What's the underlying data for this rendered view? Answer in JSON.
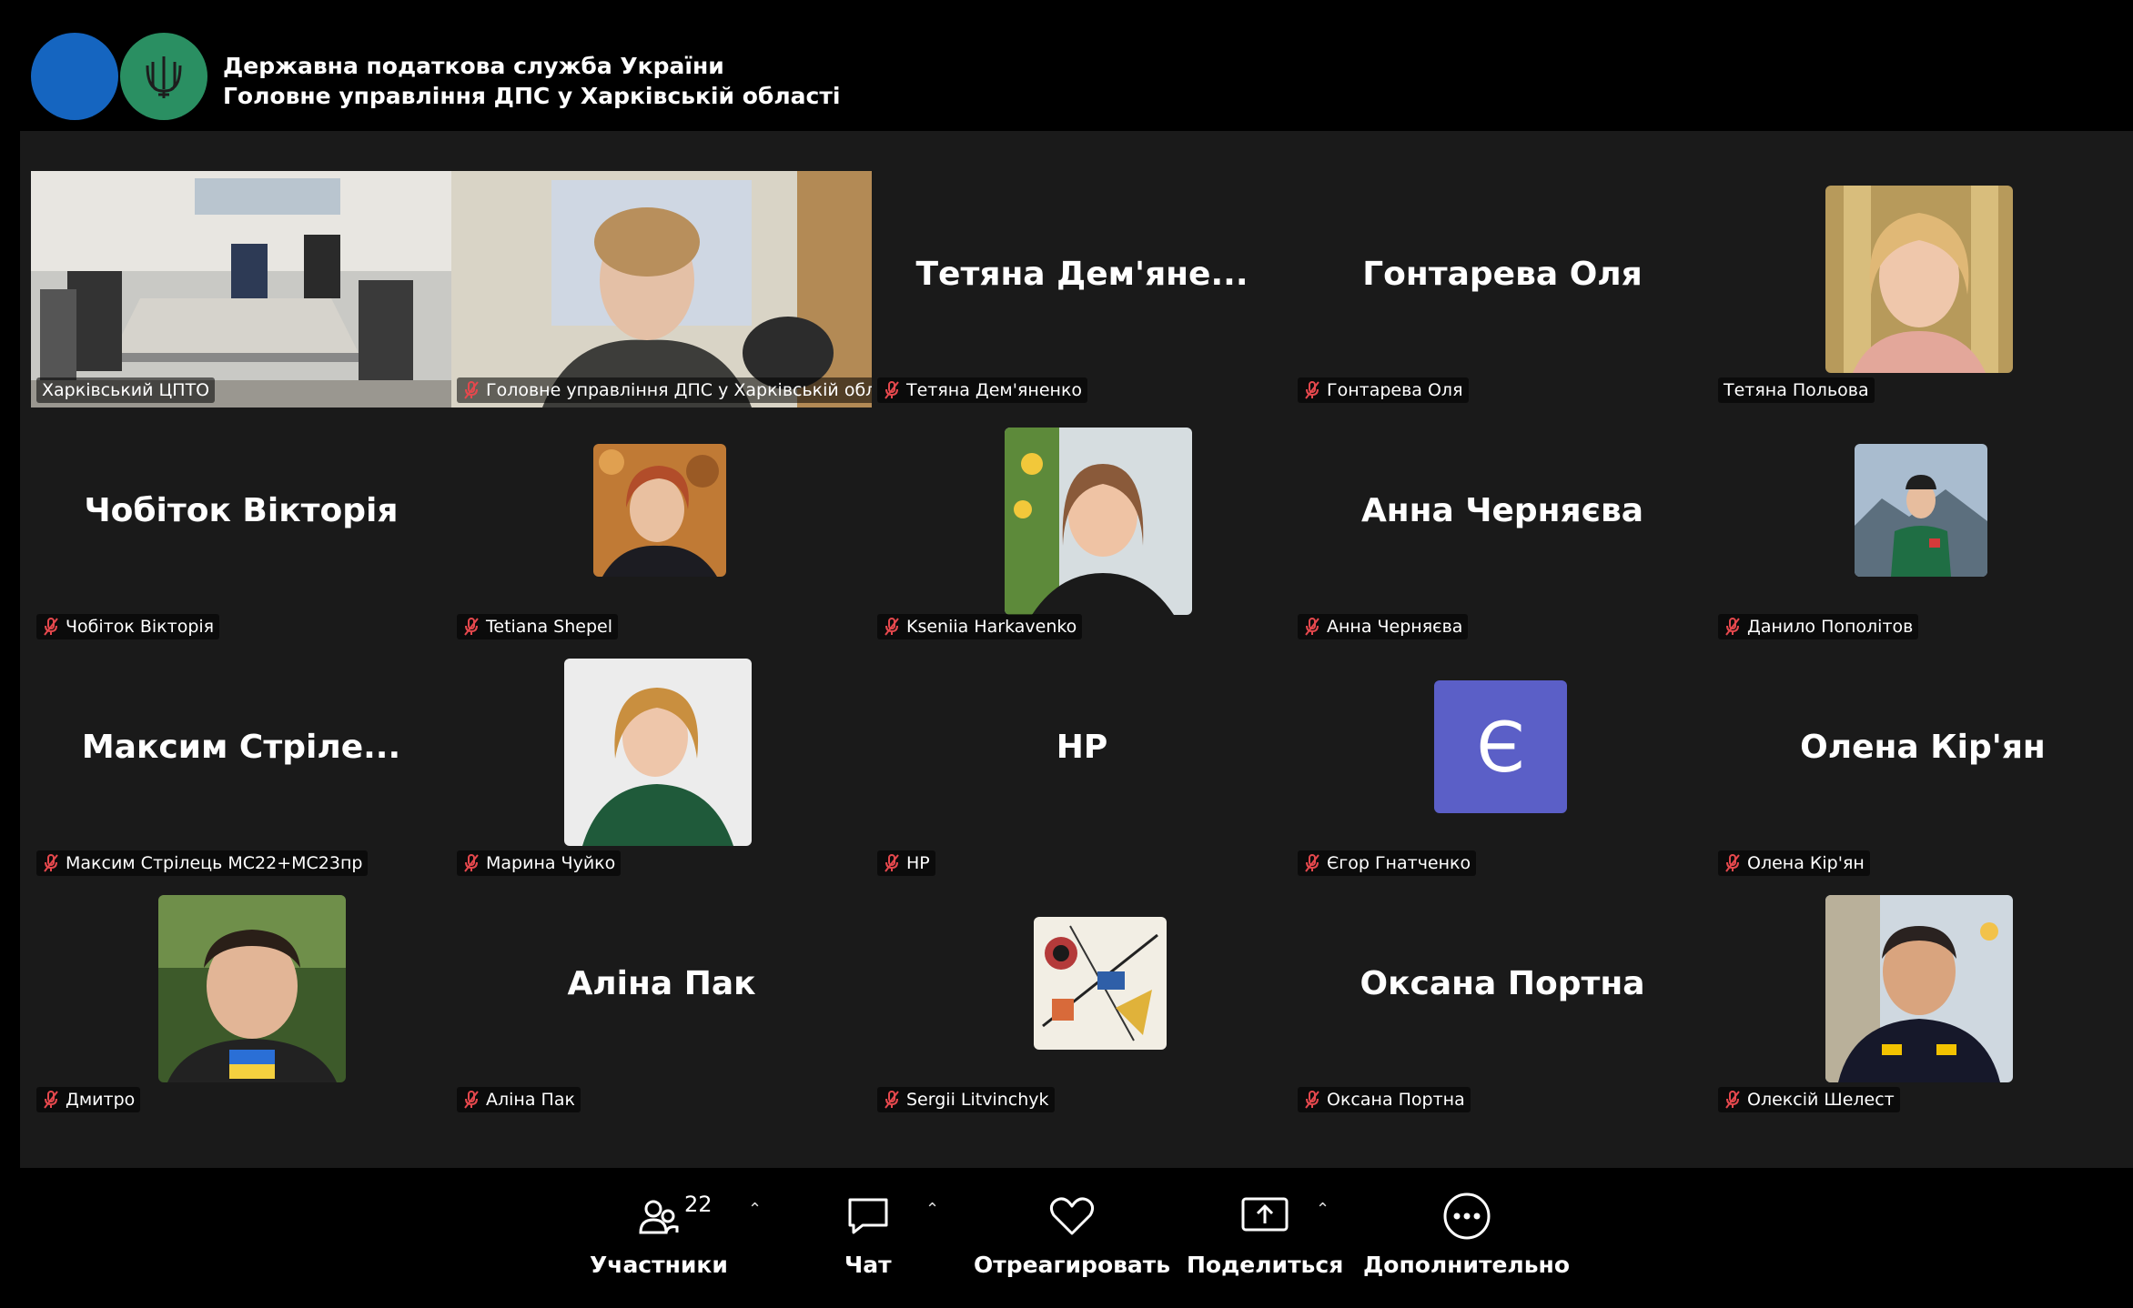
{
  "header": {
    "org_line1": "Державна податкова служба України",
    "org_line2": "Головне управління ДПС у Харківській області",
    "logo_icon": "trident-icon"
  },
  "tiles": [
    {
      "caption": "Харківський ЦПТО",
      "active": true,
      "muted": false,
      "kind": "video"
    },
    {
      "caption": "Головне управління ДПС у Харківській області",
      "muted": true,
      "kind": "video"
    },
    {
      "name": "Тетяна  Дем'яне...",
      "caption": "Тетяна Дем'яненко",
      "muted": true,
      "kind": "name"
    },
    {
      "name": "Гонтарева Оля",
      "caption": "Гонтарева Оля",
      "muted": true,
      "kind": "name"
    },
    {
      "caption": "Тетяна Польова",
      "muted": false,
      "kind": "photo"
    },
    {
      "name": "Чобіток Вікторія",
      "caption": "Чобіток Вікторія",
      "muted": true,
      "kind": "name"
    },
    {
      "caption": "Tetiana Shepel",
      "muted": true,
      "kind": "photo"
    },
    {
      "caption": "Kseniia Harkavenko",
      "muted": true,
      "kind": "photo"
    },
    {
      "name": "Анна Черняєва",
      "caption": "Анна Черняєва",
      "muted": true,
      "kind": "name"
    },
    {
      "caption": "Данило Пополітов",
      "muted": true,
      "kind": "photo"
    },
    {
      "name": "Максим  Стріле...",
      "caption": "Максим Стрілець МС22+МС23пр",
      "muted": true,
      "kind": "name"
    },
    {
      "caption": "Марина Чуйко",
      "muted": true,
      "kind": "photo"
    },
    {
      "name": "HP",
      "caption": "HP",
      "muted": true,
      "kind": "name"
    },
    {
      "avatar_letter": "Є",
      "caption": "Єгор Гнатченко",
      "muted": true,
      "kind": "avatar"
    },
    {
      "name": "Олена Кір'ян",
      "caption": "Олена Кір'ян",
      "muted": true,
      "kind": "name"
    },
    {
      "caption": "Дмитро",
      "muted": true,
      "kind": "photo"
    },
    {
      "name": "Аліна Пак",
      "caption": "Аліна Пак",
      "muted": true,
      "kind": "name"
    },
    {
      "caption": "Sergii Litvinchyk",
      "muted": true,
      "kind": "photo"
    },
    {
      "name": "Оксана Портна",
      "caption": "Оксана Портна",
      "muted": true,
      "kind": "name"
    },
    {
      "caption": "Олексій Шелест",
      "muted": true,
      "kind": "photo"
    }
  ],
  "toolbar": {
    "participants_label": "Участники",
    "participants_count": "22",
    "chat_label": "Чат",
    "react_label": "Отреагировать",
    "share_label": "Поделиться",
    "more_label": "Дополнительно"
  },
  "colors": {
    "active_border": "#2ee07a",
    "mute_red": "#e5484d",
    "avatar_bg": "#5b5fc7",
    "logo_blue": "#1565c0",
    "logo_green": "#2a8f62"
  }
}
